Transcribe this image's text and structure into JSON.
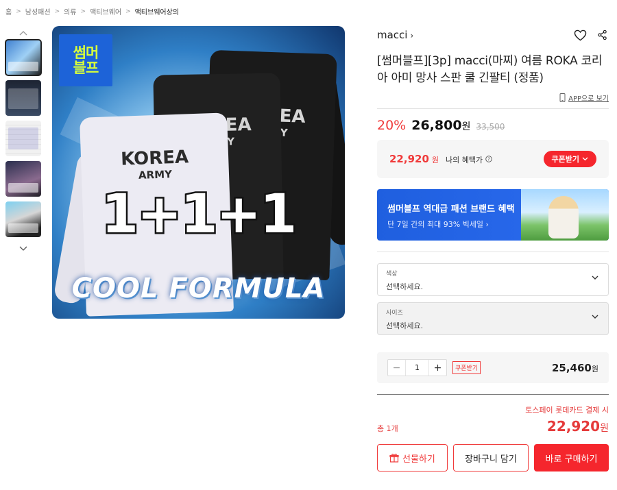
{
  "breadcrumb": [
    "홈",
    "남성패션",
    "의류",
    "액티브웨어",
    "액티브웨어상의"
  ],
  "main_image": {
    "badge_line1": "썸머",
    "badge_line2": "블프",
    "shirt_text_1": "KOREA",
    "shirt_text_2": "ARMY",
    "slogan": "1+1+1",
    "brand_slogan": "COOL FORMULA"
  },
  "store": {
    "name": "macci",
    "chevron": "›"
  },
  "product": {
    "title": "[썸머블프][3p] macci(마찌) 여름 ROKA 코리아 아미 망사 스판 쿨 긴팔티 (정품)",
    "app_view": "APP으로 보기"
  },
  "price": {
    "discount": "20%",
    "sale": "26,800",
    "unit": "원",
    "original": "33,500"
  },
  "benefit": {
    "price": "22,920",
    "unit": "원",
    "label": "나의 혜택가",
    "coupon_button": "쿠폰받기"
  },
  "banner": {
    "title": "썸머블프 역대급 패션 브랜드 혜택",
    "subtitle": "단 7일 간의 최대 93% 빅세일 ›"
  },
  "options": [
    {
      "label": "색상",
      "value": "선택하세요."
    },
    {
      "label": "사이즈",
      "value": "선택하세요."
    }
  ],
  "quantity": {
    "minus": "−",
    "value": "1",
    "plus": "+",
    "coupon": "쿠폰받기",
    "price": "25,460",
    "unit": "원"
  },
  "total": {
    "pay_note": "토스페이 롯데카드 결제 시",
    "count": "총 1개",
    "price": "22,920",
    "unit": "원"
  },
  "buttons": {
    "gift": "선물하기",
    "cart": "장바구니 담기",
    "buy": "바로 구매하기"
  },
  "colors": {
    "accent_red": "#f5262d",
    "banner_blue": "#1f5fdf",
    "badge_yellow": "#d8ff3a"
  }
}
